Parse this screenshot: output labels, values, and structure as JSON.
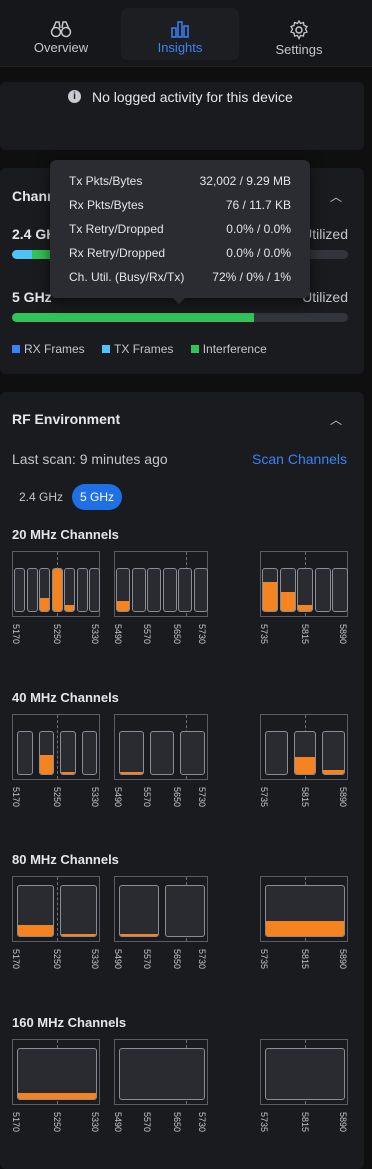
{
  "nav": {
    "items": [
      {
        "label": "Overview",
        "icon": "binoculars-icon"
      },
      {
        "label": "Insights",
        "icon": "chart-bars-icon"
      },
      {
        "label": "Settings",
        "icon": "gear-icon"
      }
    ],
    "active": "Insights",
    "accent": "#3b82f6"
  },
  "notice": {
    "text": "No logged activity for this device",
    "icon": "info-icon"
  },
  "channel_card": {
    "title_partial": "Chann",
    "band_24_label": "2.4 GHz",
    "band_24_util": "Utilized",
    "band_5_label": "5 GHz",
    "band_5_util": "Utilized",
    "band_24_fill": {
      "rx": 0.05,
      "tx": 0.02,
      "interference": 0.08
    },
    "band_5_fill": {
      "rx": 0.0,
      "tx": 0.0,
      "interference": 0.72
    },
    "legend": [
      {
        "label": "RX Frames",
        "color": "#3b82f6"
      },
      {
        "label": "TX Frames",
        "color": "#4fc3f7"
      },
      {
        "label": "Interference",
        "color": "#34c25a"
      }
    ]
  },
  "tooltip": {
    "rows": [
      {
        "key": "Tx Pkts/Bytes",
        "value": "32,002 / 9.29 MB"
      },
      {
        "key": "Rx Pkts/Bytes",
        "value": "76 / 11.7 KB"
      },
      {
        "key": "Tx Retry/Dropped",
        "value": "0.0% / 0.0%"
      },
      {
        "key": "Rx Retry/Dropped",
        "value": "0.0% / 0.0%"
      },
      {
        "key": "Ch. Util. (Busy/Rx/Tx)",
        "value": "72% / 0% / 1%"
      }
    ]
  },
  "rf": {
    "title": "RF Environment",
    "last_scan": "Last scan: 9 minutes ago",
    "scan_button": "Scan Channels",
    "bands": [
      "2.4 GHz",
      "5 GHz"
    ],
    "active_band": "5 GHz",
    "tick_labels": [
      [
        "5170",
        "5250",
        "5330"
      ],
      [
        "5490",
        "5570",
        "5650",
        "5730"
      ],
      [
        "5735",
        "5815",
        "5890"
      ]
    ],
    "sections": [
      {
        "label": "20 MHz Channels",
        "util": [
          [
            0,
            0,
            0.3,
            1,
            0.15,
            0,
            0
          ],
          [
            0.25,
            0,
            0,
            0,
            0,
            0
          ],
          [
            0.7,
            0.45,
            0.15,
            0,
            0
          ]
        ]
      },
      {
        "label": "40 MHz Channels",
        "util": [
          [
            0,
            0.45,
            0.05,
            0
          ],
          [
            0.05,
            0,
            0
          ],
          [
            0,
            0.4,
            0.1
          ]
        ]
      },
      {
        "label": "80 MHz Channels",
        "util": [
          [
            0.22,
            0.05
          ],
          [
            0.05,
            0
          ],
          [
            0.3
          ]
        ]
      },
      {
        "label": "160 MHz Channels",
        "util": [
          [
            0.12
          ],
          [
            0
          ],
          [
            0
          ]
        ]
      }
    ],
    "fill_color": "#f5831f"
  }
}
